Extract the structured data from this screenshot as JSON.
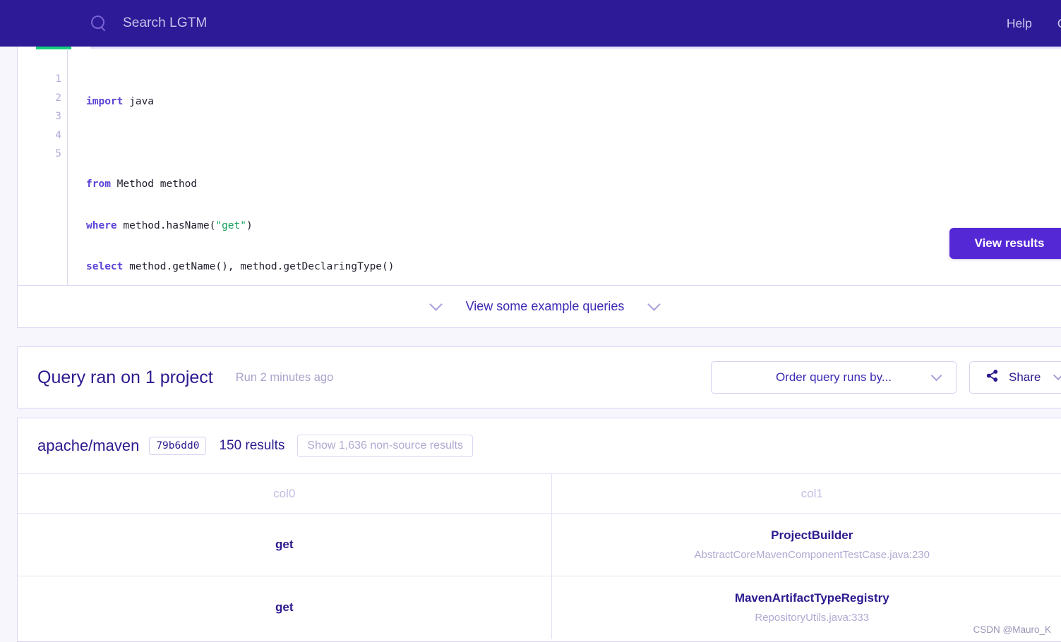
{
  "header": {
    "search_placeholder": "Search LGTM",
    "search_icon": "search-icon",
    "nav": [
      {
        "label": "Help"
      },
      {
        "label": "Que"
      }
    ]
  },
  "editor": {
    "active_tab_accent": "#13ce7c",
    "lines": [
      {
        "number": "1",
        "tokens": [
          {
            "text": "import",
            "type": "keyword"
          },
          {
            "text": " java",
            "type": "plain"
          }
        ]
      },
      {
        "number": "2",
        "tokens": []
      },
      {
        "number": "3",
        "tokens": [
          {
            "text": "from",
            "type": "keyword"
          },
          {
            "text": " Method method",
            "type": "plain"
          }
        ]
      },
      {
        "number": "4",
        "tokens": [
          {
            "text": "where",
            "type": "keyword"
          },
          {
            "text": " method.hasName(",
            "type": "plain"
          },
          {
            "text": "\"get\"",
            "type": "string"
          },
          {
            "text": ")",
            "type": "plain"
          }
        ]
      },
      {
        "number": "5",
        "tokens": [
          {
            "text": "select",
            "type": "keyword"
          },
          {
            "text": " method.getName(), method.getDeclaringType()",
            "type": "plain"
          }
        ]
      }
    ],
    "run_button_label": "View results",
    "run_button_color": "#5528d6"
  },
  "examples": {
    "label": "View some example queries"
  },
  "results_header": {
    "title": "Query ran on 1 project",
    "subtitle": "Run 2 minutes ago",
    "order_select_label": "Order query runs by...",
    "share_label": "Share",
    "share_icon": "share-icon"
  },
  "project": {
    "name": "apache/maven",
    "commit": "79b6dd0",
    "result_count": "150 results",
    "nonsource_button": "Show 1,636 non-source results",
    "collapse_icon": "chevron-up-icon"
  },
  "table": {
    "columns": [
      "col0",
      "col1"
    ],
    "rows": [
      {
        "col0": {
          "main": "get",
          "sub": ""
        },
        "col1": {
          "main": "ProjectBuilder",
          "sub": "AbstractCoreMavenComponentTestCase.java:230"
        }
      },
      {
        "col0": {
          "main": "get",
          "sub": ""
        },
        "col1": {
          "main": "MavenArtifactTypeRegistry",
          "sub": "RepositoryUtils.java:333"
        }
      }
    ]
  },
  "watermark": {
    "text": "CSDN @Mauro_K"
  }
}
